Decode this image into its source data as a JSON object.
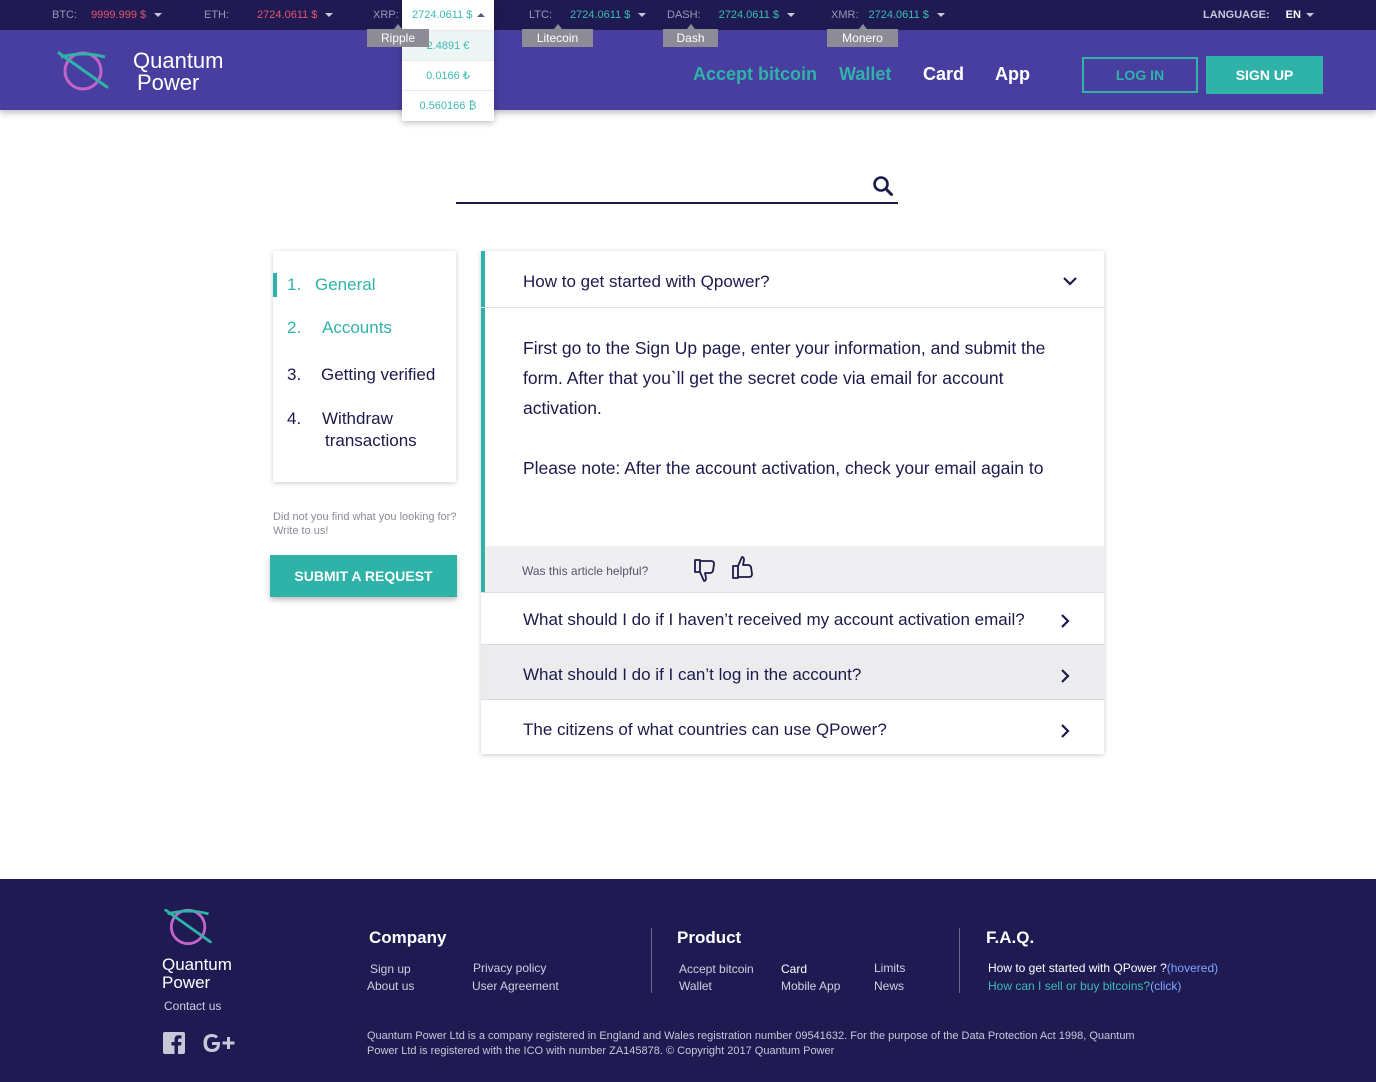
{
  "ticker": {
    "btc": {
      "label": "BTC:",
      "value": "9999.999 $"
    },
    "eth": {
      "label": "ETH:",
      "value": "2724.0611 $"
    },
    "xrp": {
      "label": "XRP:",
      "value": "2724.0611 $",
      "tooltip": "Ripple",
      "options": [
        "2.4891 €",
        "0.0166 ₺",
        "0.560166 ₿"
      ]
    },
    "ltc": {
      "label": "LTC:",
      "value": "2724.0611 $",
      "tooltip": "Litecoin"
    },
    "dash": {
      "label": "DASH:",
      "value": "2724.0611 $",
      "tooltip": "Dash"
    },
    "xmr": {
      "label": "XMR:",
      "value": "2724.0611 $",
      "tooltip": "Monero"
    },
    "language_label": "LANGUAGE:",
    "language_value": "EN"
  },
  "header": {
    "logo_line1": "Quantum",
    "logo_line2": "Power",
    "nav": [
      "Accept bitcoin",
      "Wallet",
      "Card",
      "App"
    ],
    "login": "LOG IN",
    "signup": "SIGN UP"
  },
  "search": {
    "placeholder": ""
  },
  "sidebar": {
    "items": [
      {
        "num": "1.",
        "label": "General"
      },
      {
        "num": "2.",
        "label": "Accounts"
      },
      {
        "num": "3.",
        "label": "Getting verified"
      },
      {
        "num": "4.",
        "label": "Withdraw",
        "label2": "transactions"
      }
    ],
    "note": "Did not you find what you looking for? Write to us!",
    "submit": "SUBMIT A REQUEST"
  },
  "faq": {
    "open_question": "How to get started with Qpower?",
    "answer_p1": "First go to the Sign Up page, enter your information, and submit the form. After that you`ll get the secret code via email for account activation.",
    "answer_p2": "Please note: After the account activation, check your email again to",
    "helpful_label": "Was this article helpful?",
    "questions": [
      "What should I do if I haven’t received my account activation email?",
      "What should I do if I can’t log in the account?",
      "The citizens of what countries can use QPower?"
    ]
  },
  "footer": {
    "logo_line1": "Quantum",
    "logo_line2": "Power",
    "contact": "Contact us",
    "company": {
      "title": "Company",
      "links": [
        "Sign up",
        "About us",
        "Privacy policy",
        "User Agreement"
      ]
    },
    "product": {
      "title": "Product",
      "links": [
        "Accept bitcoin",
        "Wallet",
        "Card",
        "Mobile App",
        "Limits",
        "News"
      ]
    },
    "faq": {
      "title": "F.A.Q.",
      "q1": "How to get started with QPower ?",
      "q1_state": "(hovered)",
      "q2": "How can I sell or buy bitcoins?",
      "q2_state": "(click)"
    },
    "legal": "Quantum Power Ltd is a company registered in England and Wales registration number 09541632. For the purpose of the Data Protection Act 1998, Quantum Power Ltd is registered with the ICO with number ZA145878.   © Copyright 2017 Quantum Power"
  },
  "colors": {
    "primary": "#473ea0",
    "dark": "#1f1a52",
    "accent": "#2fb3a9",
    "negative": "#e4546f"
  }
}
